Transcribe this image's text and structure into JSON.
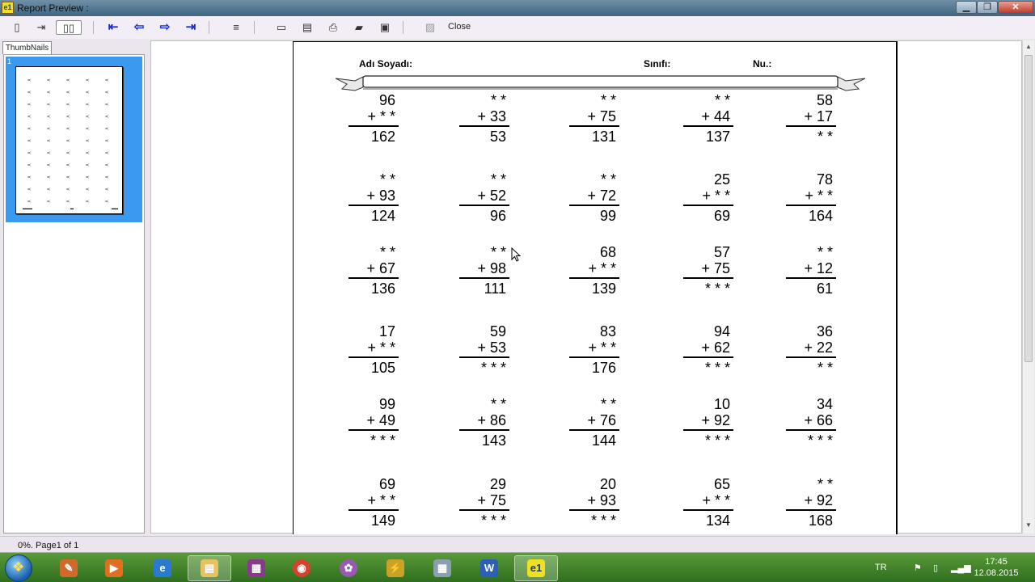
{
  "window": {
    "title": "Report Preview :",
    "app_icon": "e1"
  },
  "toolbar": {
    "close_label": "Close"
  },
  "thumbnails": {
    "tab_label": "ThumbNails",
    "page_number": "1"
  },
  "status": {
    "text": "0%. Page1 of 1"
  },
  "worksheet": {
    "name_label": "Adı Soyadı:",
    "class_label": "Sınıfı:",
    "number_label": "Nu.:",
    "rows": [
      [
        [
          "96",
          "+ * *",
          "162"
        ],
        [
          "* *",
          "+ 33",
          "53"
        ],
        [
          "* *",
          "+ 75",
          "131"
        ],
        [
          "* *",
          "+ 44",
          "137"
        ],
        [
          "58",
          "+ 17",
          "* *"
        ]
      ],
      [
        [
          "* *",
          "+ 93",
          "124"
        ],
        [
          "* *",
          "+ 52",
          "96"
        ],
        [
          "* *",
          "+ 72",
          "99"
        ],
        [
          "25",
          "+ * *",
          "69"
        ],
        [
          "78",
          "+ * *",
          "164"
        ]
      ],
      [
        [
          "* *",
          "+ 67",
          "136"
        ],
        [
          "* *",
          "+ 98",
          "111"
        ],
        [
          "68",
          "+ * *",
          "139"
        ],
        [
          "57",
          "+ 75",
          "* * *"
        ],
        [
          "* *",
          "+ 12",
          "61"
        ]
      ],
      [
        [
          "17",
          "+ * *",
          "105"
        ],
        [
          "59",
          "+ 53",
          "* * *"
        ],
        [
          "83",
          "+ * *",
          "176"
        ],
        [
          "94",
          "+ 62",
          "* * *"
        ],
        [
          "36",
          "+ 22",
          "* *"
        ]
      ],
      [
        [
          "99",
          "+ 49",
          "* * *"
        ],
        [
          "* *",
          "+ 86",
          "143"
        ],
        [
          "* *",
          "+ 76",
          "144"
        ],
        [
          "10",
          "+ 92",
          "* * *"
        ],
        [
          "34",
          "+ 66",
          "* * *"
        ]
      ],
      [
        [
          "69",
          "+ * *",
          "149"
        ],
        [
          "29",
          "+ 75",
          "* * *"
        ],
        [
          "20",
          "+ 93",
          "* * *"
        ],
        [
          "65",
          "+ * *",
          "134"
        ],
        [
          "* *",
          "+ 92",
          "168"
        ]
      ]
    ]
  },
  "taskbar": {
    "apps": [
      "explorer-folder",
      "paint",
      "media-player",
      "internet-explorer",
      "file-manager",
      "archive",
      "chrome",
      "picasa",
      "tool",
      "calculator",
      "word",
      "e1-app"
    ],
    "language": "TR",
    "time": "17:45",
    "date": "12.08.2015"
  },
  "colors": {
    "nav_arrows": "#1b2fd0",
    "selection": "#3b9af0",
    "taskbar": "#3f7f2a"
  }
}
